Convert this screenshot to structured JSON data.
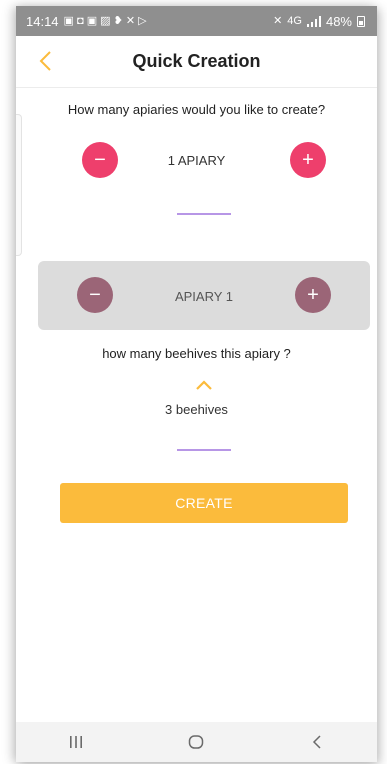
{
  "status_bar": {
    "time": "14:14",
    "signal_text": "4G",
    "battery_percent": "48%"
  },
  "header": {
    "title": "Quick Creation",
    "back_icon": "chevron-left-icon"
  },
  "apiaries": {
    "question": "How many apiaries would you like to create?",
    "count_label": "1 APIARY",
    "decrement_symbol": "−",
    "increment_symbol": "+"
  },
  "apiary_card": {
    "label": "APIARY 1",
    "decrement_symbol": "−",
    "increment_symbol": "+"
  },
  "beehives": {
    "question": "how many beehives this apiary ?",
    "count_label": "3 beehives"
  },
  "actions": {
    "create_label": "CREATE"
  },
  "colors": {
    "accent_yellow": "#fbbb3c",
    "pink": "#ee3f6c",
    "mauve": "#9b6577",
    "underline": "#b796e6"
  }
}
